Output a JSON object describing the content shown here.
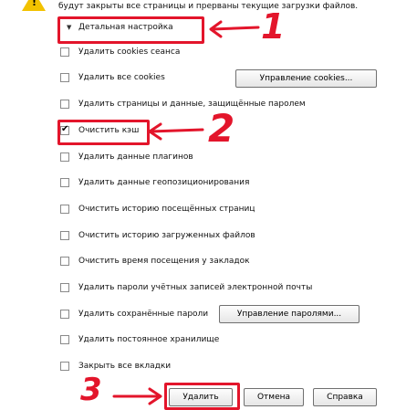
{
  "header": {
    "warning_icon": "warning-triangle-icon",
    "text": "будут закрыты все страницы и прерваны текущие загрузки файлов."
  },
  "details": {
    "label": "Детальная настройка",
    "icon": "triangle-down-icon"
  },
  "options": [
    {
      "label": "Удалить cookies сеанса",
      "checked": false
    },
    {
      "label": "Удалить все cookies",
      "checked": false
    },
    {
      "label": "Удалить страницы и данные, защищённые паролем",
      "checked": false
    },
    {
      "label": "Очистить кэш",
      "checked": true
    },
    {
      "label": "Удалить данные плагинов",
      "checked": false
    },
    {
      "label": "Удалить данные геопозиционирования",
      "checked": false
    },
    {
      "label": "Очистить историю посещённых страниц",
      "checked": false
    },
    {
      "label": "Очистить историю загруженных файлов",
      "checked": false
    },
    {
      "label": "Очистить время посещения у закладок",
      "checked": false
    },
    {
      "label": "Удалить пароли учётных записей электронной почты",
      "checked": false
    },
    {
      "label": "Удалить сохранённые пароли",
      "checked": false
    },
    {
      "label": "Удалить постоянное хранилище",
      "checked": false
    },
    {
      "label": "Закрыть все вкладки",
      "checked": false
    }
  ],
  "buttons": {
    "manage_cookies": "Управление cookies...",
    "manage_passwords": "Управление паролями...",
    "delete": "Удалить",
    "cancel": "Отмена",
    "help": "Справка"
  },
  "annotations": {
    "step1": "1",
    "step2": "2",
    "step3": "3"
  },
  "colors": {
    "annotation_red": "#e3152b",
    "warning_yellow": "#f2c200"
  }
}
